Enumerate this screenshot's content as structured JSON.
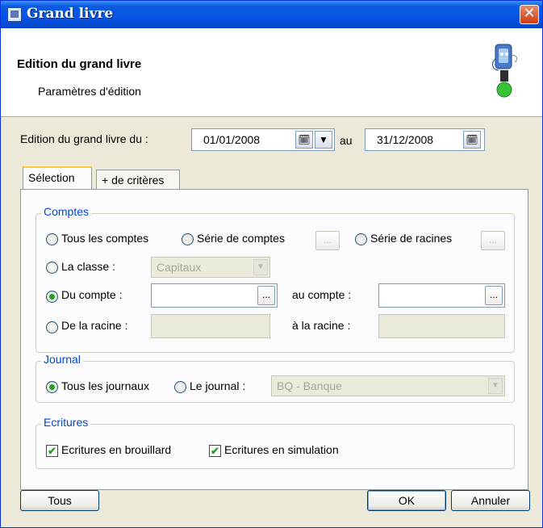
{
  "window": {
    "title": "Grand livre",
    "close_glyph": "✕"
  },
  "header": {
    "title": "Edition du grand livre",
    "subtitle": "Paramètres d'édition"
  },
  "date_range": {
    "label": "Edition du grand livre du :",
    "from": "01/01/2008",
    "to_label": "au",
    "to": "31/12/2008"
  },
  "tabs": [
    {
      "label": "Sélection",
      "active": true
    },
    {
      "label": "+ de critères",
      "active": false
    }
  ],
  "comptes": {
    "legend": "Comptes",
    "radio_all": "Tous les comptes",
    "radio_series": "Série de comptes",
    "radio_roots": "Série de racines",
    "radio_class": "La classe :",
    "class_value": "Capitaux",
    "radio_from_account": "Du compte :",
    "to_account_label": "au compte :",
    "radio_from_root": "De la racine :",
    "to_root_label": "à la racine :",
    "ellipsis": "...",
    "selected": "from_account"
  },
  "journal": {
    "legend": "Journal",
    "radio_all": "Tous les journaux",
    "radio_one": "Le journal :",
    "journal_value": "BQ - Banque",
    "selected": "all"
  },
  "ecritures": {
    "legend": "Ecritures",
    "draft_label": "Ecritures en brouillard",
    "draft_checked": true,
    "sim_label": "Ecritures en simulation",
    "sim_checked": true,
    "check_glyph": "✔"
  },
  "footer": {
    "all_button": "Tous",
    "ok_button": "OK",
    "cancel_button": "Annuler"
  },
  "icons": {
    "calendar": "calendar-icon",
    "dropdown": "chevron-down-icon"
  },
  "colors": {
    "title_bar": "#0554e6",
    "legend_text": "#0046d5",
    "check_green": "#21a121",
    "close_red": "#cf3d12"
  }
}
